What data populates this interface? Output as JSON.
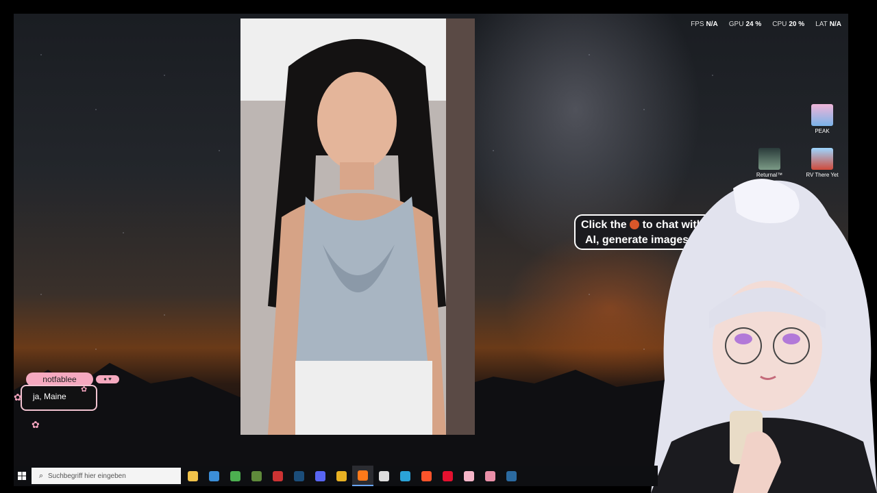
{
  "stats": [
    {
      "label": "FPS",
      "value": "N/A"
    },
    {
      "label": "GPU",
      "value": "24 %"
    },
    {
      "label": "CPU",
      "value": "20 %"
    },
    {
      "label": "LAT",
      "value": "N/A"
    }
  ],
  "desktop_icons": [
    {
      "label": "PEAK",
      "icon": "peak-game-icon"
    },
    {
      "label": "Returnal™",
      "icon": "returnal-game-icon"
    },
    {
      "label": "RV There Yet",
      "icon": "rv-there-yet-game-icon"
    }
  ],
  "chat": {
    "username": "notfablee",
    "message": "ja, Maine"
  },
  "ai_bubble": {
    "line1_before": "Click the",
    "line1_after": "to chat with",
    "line2": "AI, generate images, and more!"
  },
  "taskbar": {
    "search_placeholder": "Suchbegriff hier eingeben",
    "apps": [
      {
        "name": "file-explorer-icon",
        "color": "#f0c24a"
      },
      {
        "name": "store-icon",
        "color": "#3b8ed8"
      },
      {
        "name": "android-studio-icon",
        "color": "#4caf50"
      },
      {
        "name": "minecraft-icon",
        "color": "#5f8a3b"
      },
      {
        "name": "stream-deck-icon",
        "color": "#c33"
      },
      {
        "name": "steam-icon",
        "color": "#1b4d7a"
      },
      {
        "name": "discord-icon",
        "color": "#5865f2"
      },
      {
        "name": "chrome-icon",
        "color": "#e8b123"
      },
      {
        "name": "firefox-icon",
        "color": "#ff7a1a"
      },
      {
        "name": "obs-icon",
        "color": "#ddd"
      },
      {
        "name": "edge-icon",
        "color": "#2ba3d8"
      },
      {
        "name": "brave-icon",
        "color": "#fb542b"
      },
      {
        "name": "opera-icon",
        "color": "#e4112f"
      },
      {
        "name": "image-viewer-icon",
        "color": "#f6b5c8"
      },
      {
        "name": "pink-app-icon",
        "color": "#ea8fa8"
      },
      {
        "name": "steam-icon-2",
        "color": "#2b6aa0"
      }
    ]
  }
}
